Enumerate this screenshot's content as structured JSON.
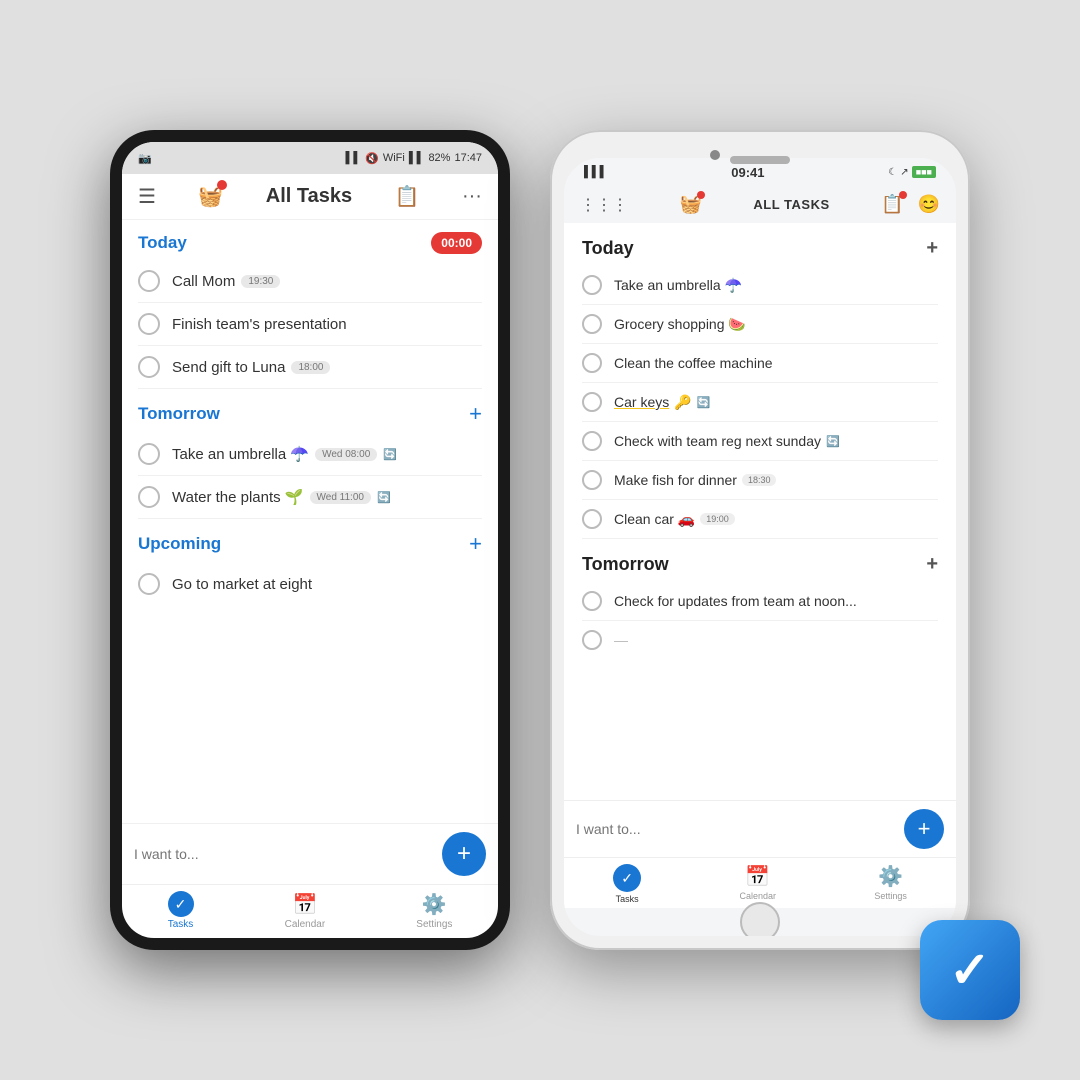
{
  "android": {
    "status": {
      "left": "📷",
      "signal": "▌▌",
      "volume": "🔇",
      "wifi": "WiFi",
      "network": "▌▌",
      "battery": "82%",
      "time": "17:47"
    },
    "header": {
      "menu_icon": "☰",
      "basket_icon": "🧺",
      "title": "All Tasks",
      "clipboard_icon": "📋",
      "more_icon": "···"
    },
    "sections": [
      {
        "label": "Today",
        "color": "blue",
        "has_plus": false,
        "tasks": [
          {
            "text": "Call Mom",
            "tag": "19:30",
            "emoji": ""
          },
          {
            "text": "Finish team's presentation",
            "tag": "",
            "emoji": ""
          },
          {
            "text": "Send gift to Luna",
            "tag": "18:00",
            "emoji": ""
          }
        ]
      },
      {
        "label": "Tomorrow",
        "color": "blue",
        "has_plus": true,
        "tasks": [
          {
            "text": "Take an umbrella",
            "emoji": "☂️",
            "tag": "Wed 08:00",
            "repeat": true
          },
          {
            "text": "Water the plants",
            "emoji": "🌱",
            "tag": "Wed 11:00",
            "repeat": true
          }
        ]
      },
      {
        "label": "Upcoming",
        "color": "blue",
        "has_plus": true,
        "tasks": [
          {
            "text": "Go to market at eight",
            "tag": "",
            "emoji": ""
          }
        ]
      }
    ],
    "input_placeholder": "I want to...",
    "tabs": [
      {
        "label": "Tasks",
        "active": true,
        "icon": "check"
      },
      {
        "label": "Calendar",
        "active": false,
        "icon": "cal"
      },
      {
        "label": "Settings",
        "active": false,
        "icon": "gear"
      }
    ]
  },
  "ios": {
    "status": {
      "signal": "▌▌▌",
      "time": "09:41",
      "moon": "☾",
      "arrow": "↗",
      "battery": "█████"
    },
    "header": {
      "grid_icon": "⋮⋮⋮",
      "basket_icon": "🧺",
      "title": "ALL TASKS",
      "clipboard_icon": "📋",
      "face_icon": "😊"
    },
    "sections": [
      {
        "label": "Today",
        "has_plus": true,
        "tasks": [
          {
            "text": "Take an umbrella",
            "emoji": "☂️",
            "tag": ""
          },
          {
            "text": "Grocery shopping",
            "emoji": "🍉",
            "tag": ""
          },
          {
            "text": "Clean the coffee machine",
            "emoji": "",
            "tag": ""
          },
          {
            "text": "Car keys",
            "emoji": "🔑",
            "tag": "",
            "repeat": true,
            "underline": true
          },
          {
            "text": "Check with team reg next sunday",
            "emoji": "",
            "tag": "",
            "repeat": true
          },
          {
            "text": "Make fish for dinner",
            "emoji": "",
            "tag": "18:30"
          },
          {
            "text": "Clean car",
            "emoji": "🚗",
            "tag": "19:00"
          }
        ]
      },
      {
        "label": "Tomorrow",
        "has_plus": true,
        "tasks": [
          {
            "text": "Check for updates from team at noon...",
            "emoji": "",
            "tag": ""
          },
          {
            "text": "...",
            "emoji": "",
            "tag": ""
          }
        ]
      }
    ],
    "input_placeholder": "I want to...",
    "tabs": [
      {
        "label": "Tasks",
        "active": true,
        "icon": "check"
      },
      {
        "label": "Calendar",
        "active": false,
        "icon": "cal"
      },
      {
        "label": "Settings",
        "active": false,
        "icon": "gear"
      }
    ]
  },
  "app_icon": {
    "label": "Tasks App",
    "check": "✓"
  }
}
